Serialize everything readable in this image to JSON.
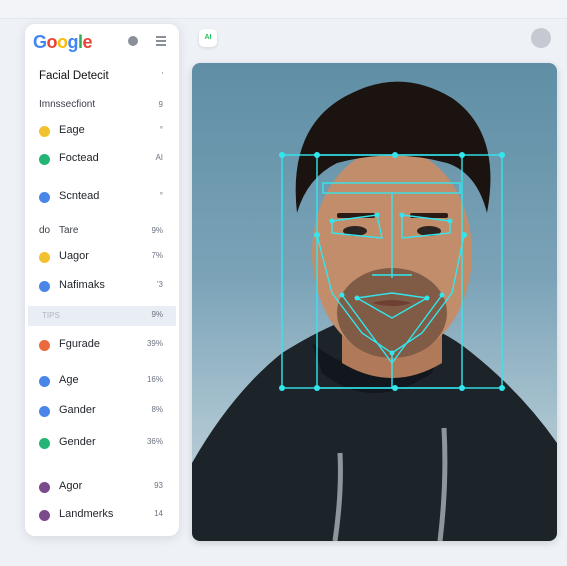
{
  "logo": {
    "letters": [
      "G",
      "o",
      "o",
      "g",
      "l",
      "e"
    ],
    "colors": [
      "#4285F4",
      "#EA4335",
      "#FBBC05",
      "#4285F4",
      "#34A853",
      "#EA4335"
    ]
  },
  "header_icons": [
    "settings-icon",
    "menu-icon"
  ],
  "panel": {
    "title": "Facial Detecit",
    "title_value": "'",
    "section1": {
      "label": "Imnssecfiont",
      "value": "9"
    },
    "items1": [
      {
        "label": "Eage",
        "value": "°",
        "color": "#F2C12E"
      },
      {
        "label": "Foctead",
        "value": "AI",
        "color": "#22B573"
      },
      {
        "label": "Scntead",
        "value": "°",
        "color": "#4A86E8"
      }
    ],
    "section2": {
      "prefix": "do",
      "label": "Tare",
      "value": "9%"
    },
    "items2": [
      {
        "label": "Uagor",
        "value": "7%",
        "color": "#F2C12E"
      },
      {
        "label": "Nafimaks",
        "value": "'3",
        "color": "#4A86E8"
      }
    ],
    "highlight": {
      "label": "TIPS",
      "value": "9%"
    },
    "items3": [
      {
        "label": "Fgurade",
        "value": "39%",
        "color": "#EA6A3E"
      },
      {
        "label": "Age",
        "value": "16%",
        "color": "#4A86E8"
      },
      {
        "label": "Gander",
        "value": "8%",
        "color": "#4A86E8"
      },
      {
        "label": "Gender",
        "value": "36%",
        "color": "#22B573"
      },
      {
        "label": "Agor",
        "value": "93",
        "color": "#7A4A8C"
      },
      {
        "label": "Landmerks",
        "value": "14",
        "color": "#7A4A8C"
      }
    ]
  },
  "toolbar": {
    "badge_text": "AI"
  },
  "overlay": {
    "accent": "#33e6ee"
  }
}
